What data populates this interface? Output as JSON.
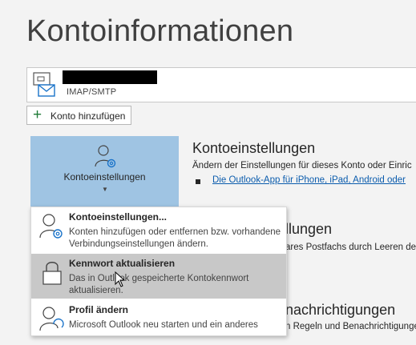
{
  "page": {
    "title": "Kontoinformationen"
  },
  "account": {
    "type": "IMAP/SMTP",
    "icon": "mail-account-icon"
  },
  "add_account": {
    "label": "Konto hinzufügen",
    "icon": "plus-icon"
  },
  "settings_button": {
    "label": "Kontoeinstellungen",
    "icon": "account-settings-icon",
    "color": "#9fc4e3"
  },
  "sections": {
    "account_settings": {
      "title": "Kontoeinstellungen",
      "text": "Ändern der Einstellungen für dieses Konto oder Einric",
      "link": "Die Outlook-App für iPhone, iPad, Android oder"
    },
    "mailbox": {
      "title": "llungen",
      "text": "ares Postfachs durch Leeren des"
    },
    "notifications": {
      "title": "nachrichtigungen",
      "text": "n Regeln und Benachrichtigungen"
    }
  },
  "dropdown": {
    "items": [
      {
        "title": "Kontoeinstellungen...",
        "title_underline": "n",
        "description": "Konten hinzufügen oder entfernen bzw. vorhandene Verbindungseinstellungen ändern.",
        "icon": "account-settings-icon",
        "active": false
      },
      {
        "title": "Kennwort aktualisieren",
        "description": "Das in Outlook gespeicherte Kontokennwort aktualisieren.",
        "icon": "lock-icon",
        "active": true
      },
      {
        "title": "Profil ändern",
        "description": "Microsoft Outlook neu starten und ein anderes",
        "icon": "profile-icon",
        "active": false
      }
    ]
  }
}
